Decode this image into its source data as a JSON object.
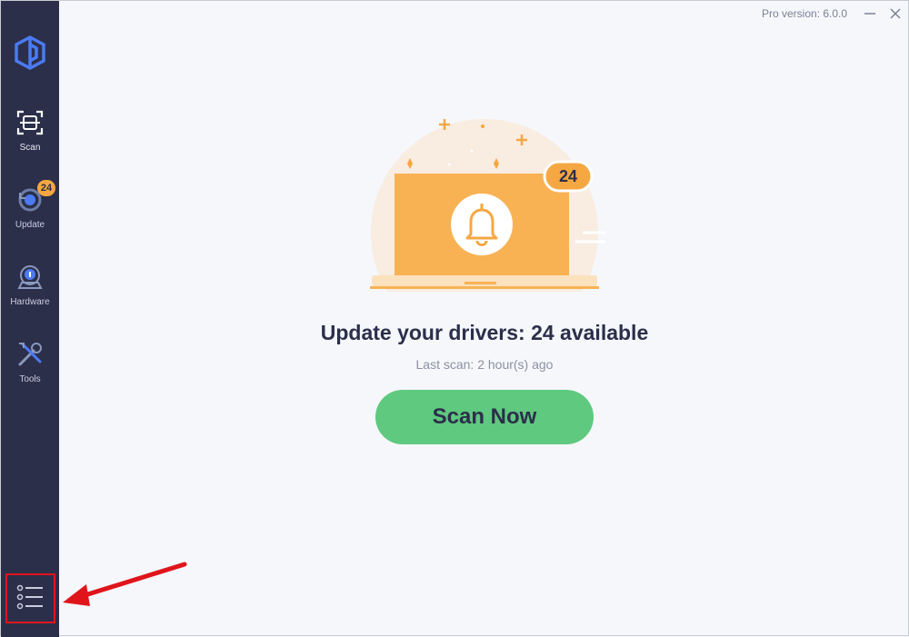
{
  "window": {
    "version_text": "Pro version: 6.0.0"
  },
  "sidebar": {
    "items": [
      {
        "label": "Scan",
        "icon": "scan-icon"
      },
      {
        "label": "Update",
        "icon": "update-icon",
        "badge": "24"
      },
      {
        "label": "Hardware",
        "icon": "hardware-icon"
      },
      {
        "label": "Tools",
        "icon": "tools-icon"
      }
    ],
    "menu_icon": "menu-list-icon"
  },
  "main": {
    "illustration_badge": "24",
    "headline": "Update your drivers: 24 available",
    "last_scan": "Last scan: 2 hour(s) ago",
    "scan_button": "Scan Now"
  },
  "colors": {
    "sidebar_bg": "#2b2f4a",
    "accent_orange": "#f5a742",
    "button_green": "#5fc97f",
    "highlight_red": "#e0151b"
  }
}
